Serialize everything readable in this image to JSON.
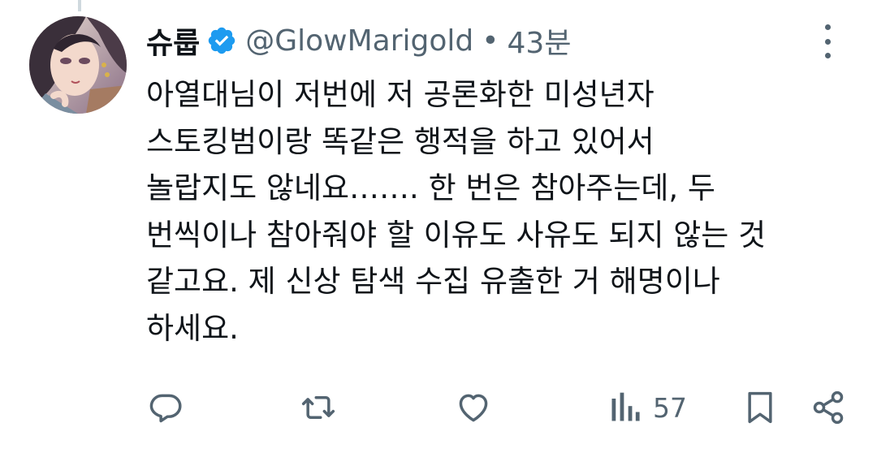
{
  "tweet": {
    "display_name": "슈룹",
    "handle": "@GlowMarigold",
    "separator": "•",
    "time": "43분",
    "body": "아열대님이 저번에 저 공론화한 미성년자\n스토킹범이랑 똑같은 행적을 하고 있어서\n놀랍지도 않네요……. 한 번은 참아주는데, 두\n번씩이나 참아줘야 할 이유도 사유도 되지 않는 것\n같고요. 제 신상 탐색 수집 유출한 거 해명이나\n하세요."
  },
  "actions": {
    "views_count": "57"
  },
  "colors": {
    "text_primary": "#0f1419",
    "text_secondary": "#536471",
    "verified_blue": "#1d9bf0",
    "thread_line": "#cfd9de"
  },
  "icons": [
    "reply-icon",
    "retweet-icon",
    "like-icon",
    "views-icon",
    "bookmark-icon",
    "share-icon",
    "more-icon",
    "verified-badge-icon"
  ]
}
